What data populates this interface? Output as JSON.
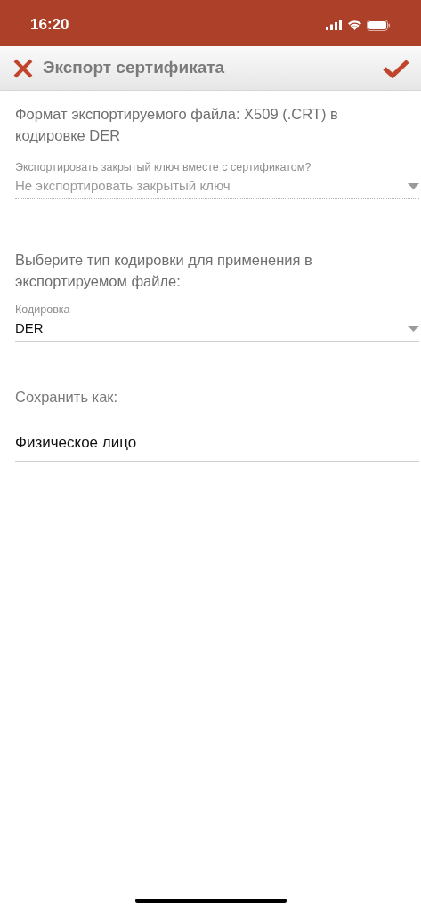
{
  "status_bar": {
    "time": "16:20"
  },
  "header": {
    "title": "Экспорт сертификата"
  },
  "format_note": "Формат экспортируемого файла: X509 (.CRT) в кодировке DER",
  "private_key_select": {
    "label": "Экспортировать закрытый ключ вместе с сертификатом?",
    "value": "Не экспортировать закрытый ключ",
    "disabled": true
  },
  "encoding_note": "Выберите тип кодировки для применения в экспортируемом файле:",
  "encoding_select": {
    "label": "Кодировка",
    "value": "DER",
    "disabled": false
  },
  "save_as": {
    "label": "Сохранить как:",
    "value": "Физическое лицо"
  }
}
